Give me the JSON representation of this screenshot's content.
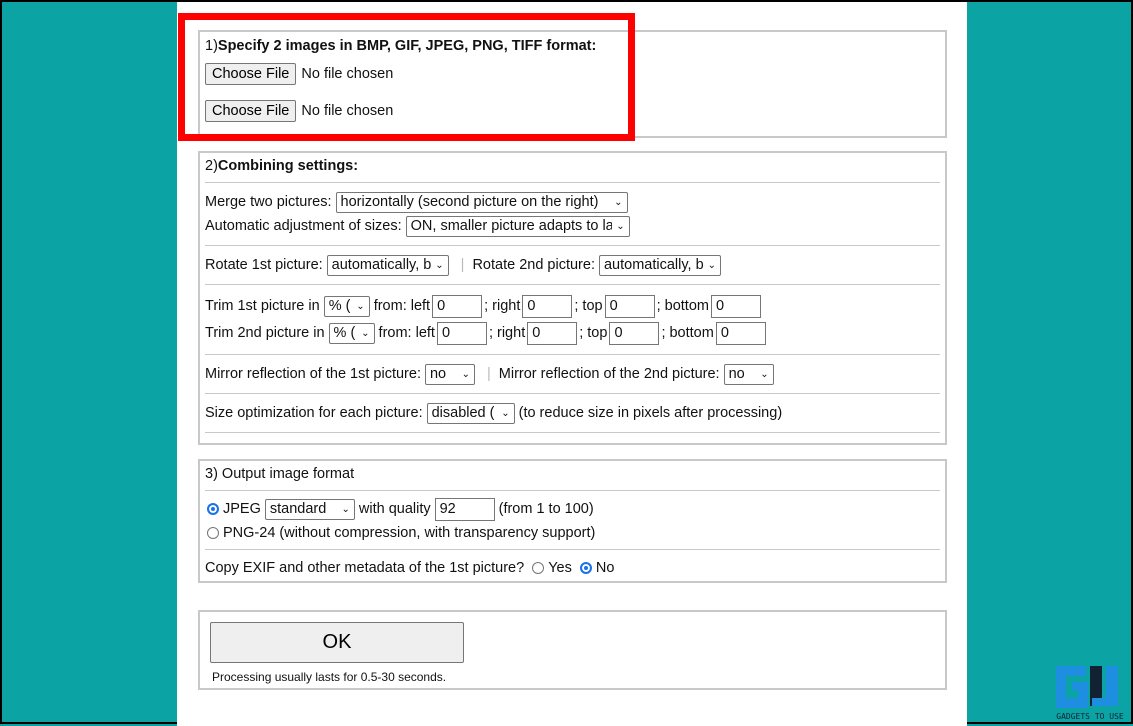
{
  "section1": {
    "number": "1) ",
    "title": "Specify 2 images in BMP, GIF, JPEG, PNG, TIFF format:",
    "choose_label": "Choose File",
    "no_file": "No file chosen"
  },
  "section2": {
    "number": "2) ",
    "title": "Combining settings:",
    "merge_label": "Merge two pictures:",
    "merge_value": "horizontally (second picture on the right)",
    "adjust_label": "Automatic adjustment of sizes:",
    "adjust_value": "ON, smaller picture adapts to la",
    "rotate1_label": "Rotate 1st picture:",
    "rotate1_value": "automatically, b",
    "rotate2_label": "Rotate 2nd picture:",
    "rotate2_value": "automatically, b",
    "trim1_label": "Trim 1st picture in",
    "trim2_label": "Trim 2nd picture in",
    "trim_unit": "% (",
    "from_left": "from: left",
    "right": "; right",
    "top": "; top",
    "bottom": "; bottom",
    "zero": "0",
    "mirror1_label": "Mirror reflection of the 1st picture:",
    "mirror2_label": "Mirror reflection of the 2nd picture:",
    "mirror_value": "no",
    "sizeopt_label": "Size optimization for each picture:",
    "sizeopt_value": "disabled (",
    "sizeopt_note": "(to reduce size in pixels after processing)"
  },
  "section3": {
    "title": "3) Output image format",
    "jpeg_label": "JPEG",
    "jpeg_mode": "standard",
    "quality_label": "with quality",
    "quality_value": "92",
    "quality_note": "(from 1 to 100)",
    "png_label": "PNG-24 (without compression, with transparency support)",
    "exif_label": "Copy EXIF and other metadata of the 1st picture?",
    "yes": "Yes",
    "no": "No"
  },
  "section4": {
    "ok_label": "OK",
    "note": "Processing usually lasts for 0.5-30 seconds."
  },
  "watermark": {
    "text": "GADGETS TO USE"
  },
  "colors": {
    "background": "#0ba3a4",
    "highlight": "#ff0000"
  }
}
